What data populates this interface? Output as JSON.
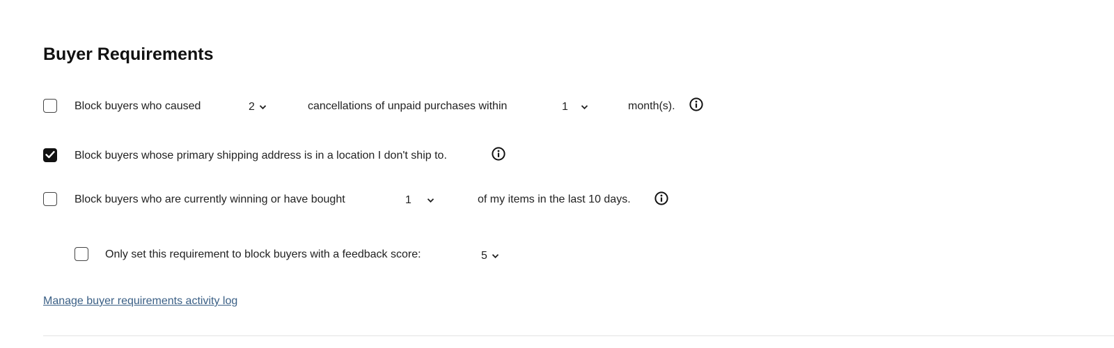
{
  "section": {
    "title": "Buyer Requirements"
  },
  "rule_unpaid": {
    "checked": false,
    "text_before": "Block buyers who caused",
    "count_value": "2",
    "text_middle": "cancellations of unpaid purchases within",
    "months_value": "1",
    "text_after": "month(s)."
  },
  "rule_shipping": {
    "checked": true,
    "text": "Block buyers whose primary shipping address is in a location I don't ship to."
  },
  "rule_items": {
    "checked": false,
    "text_before": "Block buyers who are currently winning or have bought",
    "count_value": "1",
    "text_after": "of my items in the last 10 days."
  },
  "rule_feedback": {
    "checked": false,
    "text": "Only set this requirement to block buyers with a feedback score:",
    "score_value": "5"
  },
  "footer": {
    "activity_log_link": "Manage buyer requirements activity log"
  },
  "icons": {
    "info": "info-icon",
    "chevron": "chevron-down-icon",
    "check": "check-icon"
  }
}
